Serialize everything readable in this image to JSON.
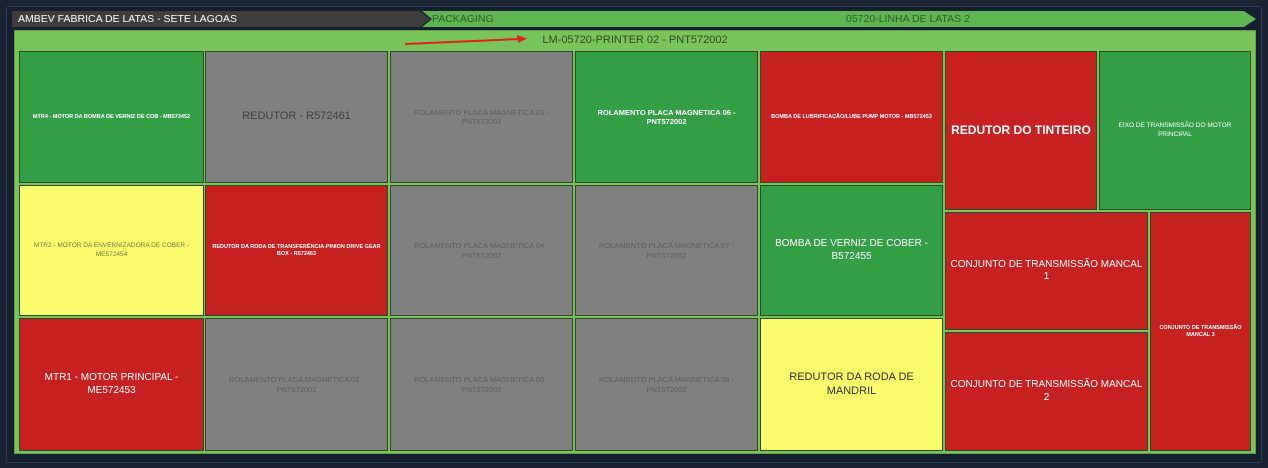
{
  "breadcrumb": [
    {
      "label": "AMBEV FABRICA DE LATAS - SETE LAGOAS"
    },
    {
      "label": "PACKAGING"
    },
    {
      "label": "05720-LINHA DE LATAS 2"
    }
  ],
  "treemap": {
    "title": "LM-05720-PRINTER 02 - PNT572002",
    "colors": {
      "ok": "#349e45",
      "alarm": "#c62020",
      "warning": "#fbfb6c",
      "offline": "#808080",
      "container": "#79c45b"
    },
    "cells": [
      {
        "label": "MTR4 - MOTOR DA BOMBA DE VERNIZ DE COB - MB572452",
        "status": "green"
      },
      {
        "label": "REDUTOR - R572461",
        "status": "gray"
      },
      {
        "label": "ROLAMENTO PLACA MAGNETICA 03 - PNT572002",
        "status": "gray"
      },
      {
        "label": "ROLAMENTO PLACA MAGNETICA 06 - PNT572002",
        "status": "green"
      },
      {
        "label": "BOMBA DE LUBRIFICAÇÃO/LUBE PUMP MOTOR - MB572453",
        "status": "red"
      },
      {
        "label": "REDUTOR DO TINTEIRO",
        "status": "red"
      },
      {
        "label": "EIXO DE TRANSMISSÃO DO MOTOR PRINCIPAL",
        "status": "green"
      },
      {
        "label": "MTR2 - MOTOR DA ENVERNIZADORA DE COBER - ME572454",
        "status": "yellow"
      },
      {
        "label": "REDUTOR DA RODA DE TRANSFERÊNCIA-PINION DRIVE GEAR BOX - R572463",
        "status": "red"
      },
      {
        "label": "ROLAMENTO PLACA MAGNETICA 04 - PNT572002",
        "status": "gray"
      },
      {
        "label": "ROLAMENTO PLACA MAGNETICA 07 - PNT572002",
        "status": "gray"
      },
      {
        "label": "BOMBA DE VERNIZ DE COBER - B572455",
        "status": "green"
      },
      {
        "label": "CONJUNTO DE TRANSMISSÃO MANCAL 1",
        "status": "red"
      },
      {
        "label": "CONJUNTO DE TRANSMISSÃO MANCAL 3",
        "status": "red"
      },
      {
        "label": "MTR1 - MOTOR PRINCIPAL - ME572453",
        "status": "red"
      },
      {
        "label": "ROLAMENTO PLACA MAGNETICA 02 - PNT572002",
        "status": "gray"
      },
      {
        "label": "ROLAMENTO PLACA MAGNETICA 05 - PNT572002",
        "status": "gray"
      },
      {
        "label": "ROLAMENTO PLACA MAGNETICA 08 - PNT572002",
        "status": "gray"
      },
      {
        "label": "REDUTOR DA RODA DE MANDRIL",
        "status": "yellow"
      },
      {
        "label": "CONJUNTO DE TRANSMISSÃO MANCAL 2",
        "status": "red"
      }
    ]
  }
}
